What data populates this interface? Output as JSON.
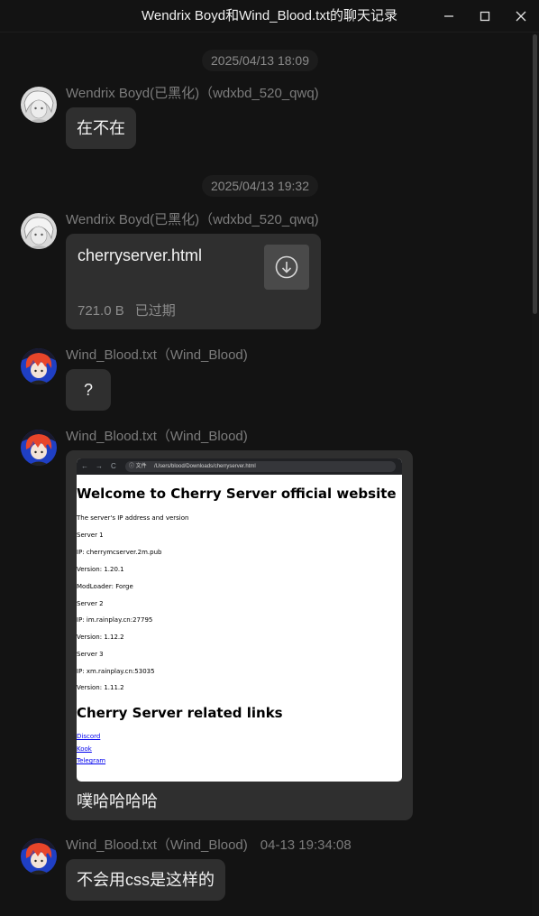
{
  "window": {
    "title": "Wendrix Boyd和Wind_Blood.txt的聊天记录",
    "minimize_icon": "minimize-icon",
    "maximize_icon": "maximize-icon",
    "close_icon": "close-icon"
  },
  "timestamps": [
    "2025/04/13 18:09",
    "2025/04/13 19:32"
  ],
  "senders": {
    "wendrix": "Wendrix Boyd(已黑化)（wdxbd_520_qwq)",
    "wind": "Wind_Blood.txt（Wind_Blood)"
  },
  "messages": [
    {
      "text": "在不在"
    },
    {
      "file_name": "cherryserver.html",
      "file_size": "721.0 B",
      "file_status": "已过期",
      "icon": "download-icon"
    },
    {
      "text": "?"
    },
    {
      "screenshot": {
        "nav_back": "←",
        "nav_forward": "→",
        "nav_reload": "C",
        "url_chip": "ⓘ 文件",
        "url": "/Users/blood/Downloads/cherryserver.html",
        "heading1": "Welcome to Cherry Server official website",
        "lines": [
          "The server's IP address and version",
          "Server 1",
          "IP: cherrymcserver.2m.pub",
          "Version: 1.20.1",
          "ModLoader: Forge",
          "Server 2",
          "IP: im.rainplay.cn:27795",
          "Version: 1.12.2",
          "Server 3",
          "IP: xm.rainplay.cn:53035",
          "Version: 1.11.2"
        ],
        "heading2": "Cherry Server related links",
        "links": [
          "Discord",
          "Kook",
          "Telegram"
        ]
      },
      "caption": "噗哈哈哈哈"
    },
    {
      "time": "04-13 19:34:08",
      "text": "不会用css是这样的"
    }
  ]
}
